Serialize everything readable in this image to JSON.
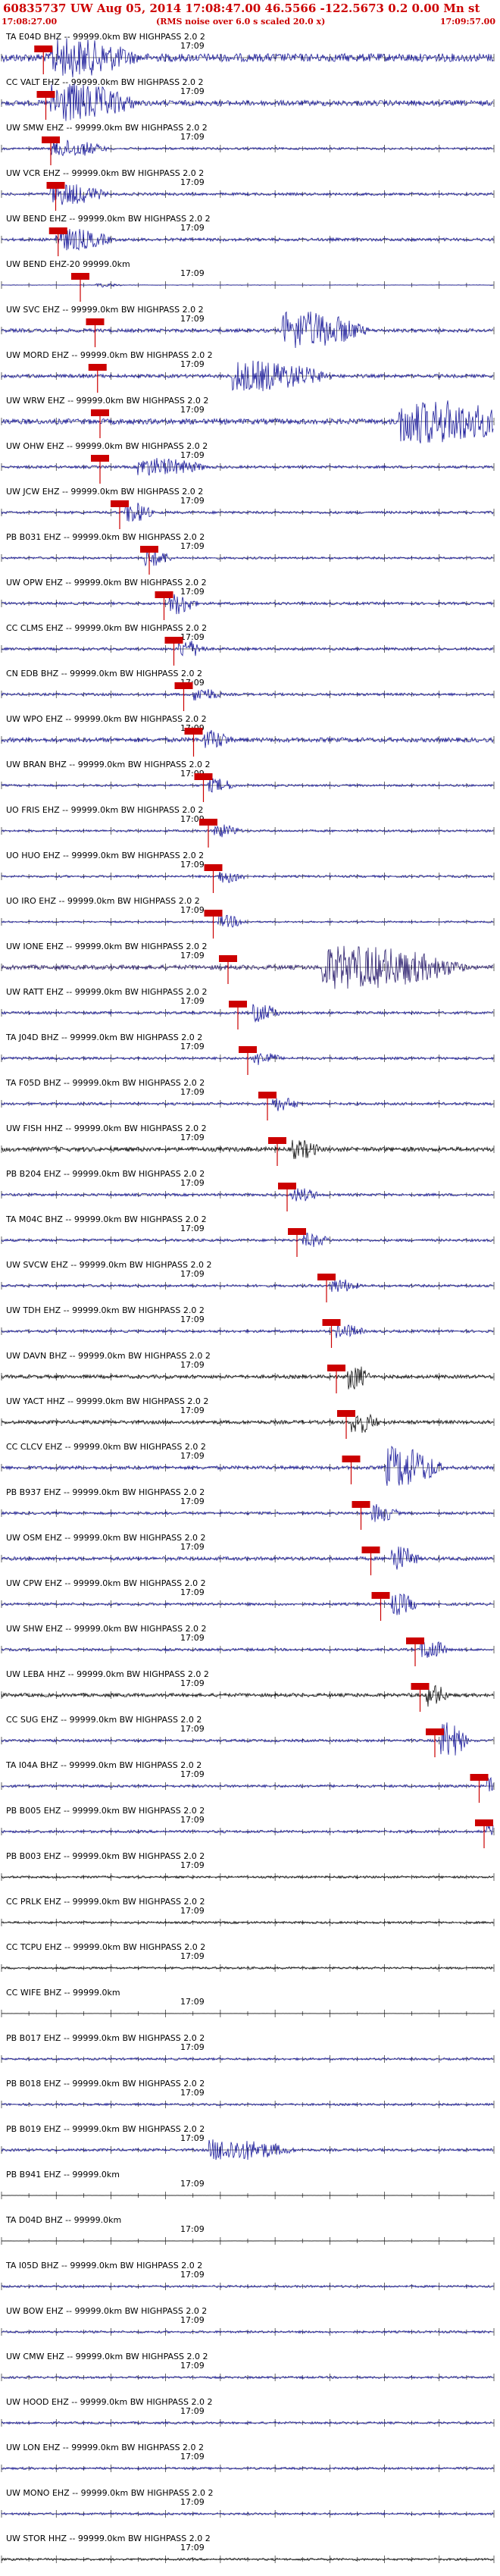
{
  "header": {
    "title": "60835737 UW Aug 05, 2014 17:08:47.00    46.5566 -122.5673   0.2 0.00 Mn st",
    "start_time": "17:08:27.00",
    "end_time": "17:09:57.00",
    "note": "(RMS noise over 6.0 s scaled 20.0 x)"
  },
  "chart_data": {
    "type": "seismogram",
    "center_tick_label": "17:09",
    "x_range": [
      "17:08:27.00",
      "17:09:57.00"
    ],
    "traces": [
      {
        "label": "TA E04D BHZ -- 99999.0km BW  HIGHPASS  2.0  2",
        "color": "#1a1a9a",
        "pick": 0.085,
        "amp": 0.9,
        "burst": [
          0.13,
          0.3,
          0.8
        ]
      },
      {
        "label": "CC VALT EHZ -- 99999.0km BW  HIGHPASS  2.0  2",
        "color": "#1a1a9a",
        "pick": 0.09,
        "amp": 0.6,
        "burst": [
          0.13,
          0.3,
          0.9
        ]
      },
      {
        "label": "UW SMW EHZ -- 99999.0km BW  HIGHPASS  2.0  2",
        "color": "#1a1a9a",
        "pick": 0.1,
        "amp": 0.25,
        "burst": [
          0.12,
          0.2,
          0.4
        ]
      },
      {
        "label": "UW VCR EHZ -- 99999.0km BW  HIGHPASS  2.0  2",
        "color": "#1a1a9a",
        "pick": 0.11,
        "amp": 0.3,
        "burst": [
          0.12,
          0.2,
          0.5
        ]
      },
      {
        "label": "UW BEND EHZ -- 99999.0km BW  HIGHPASS  2.0  2",
        "color": "#1a1a9a",
        "pick": 0.115,
        "amp": 0.35,
        "burst": [
          0.13,
          0.2,
          0.5
        ]
      },
      {
        "label": "UW BEND EHZ-20 99999.0km",
        "color": "#1a1a9a",
        "pick": 0.16,
        "amp": 0.05,
        "burst": [
          0.2,
          0.1,
          0.1
        ]
      },
      {
        "label": "UW SVC EHZ -- 99999.0km BW  HIGHPASS  2.0  2",
        "color": "#1a1a9a",
        "pick": 0.19,
        "amp": 0.4,
        "burst": [
          0.6,
          0.3,
          0.9
        ]
      },
      {
        "label": "UW MORD EHZ -- 99999.0km BW  HIGHPASS  2.0  2",
        "color": "#1a1a9a",
        "pick": 0.195,
        "amp": 0.4,
        "burst": [
          0.5,
          0.35,
          0.7
        ]
      },
      {
        "label": "UW WRW EHZ -- 99999.0km BW  HIGHPASS  2.0  2",
        "color": "#1a1a9a",
        "pick": 0.2,
        "amp": 0.6,
        "burst": [
          0.85,
          0.45,
          1.0
        ]
      },
      {
        "label": "UW OHW EHZ -- 99999.0km BW  HIGHPASS  2.0  2",
        "color": "#1a1a9a",
        "pick": 0.2,
        "amp": 0.3,
        "burst": [
          0.3,
          0.25,
          0.4
        ]
      },
      {
        "label": "UW JCW EHZ -- 99999.0km BW  HIGHPASS  2.0  2",
        "color": "#1a1a9a",
        "pick": 0.24,
        "amp": 0.3,
        "burst": [
          0.26,
          0.1,
          0.5
        ]
      },
      {
        "label": "PB B031 EHZ -- 99999.0km BW  HIGHPASS  2.0  2",
        "color": "#1a1a9a",
        "pick": 0.3,
        "amp": 0.25,
        "burst": [
          0.3,
          0.1,
          0.4
        ]
      },
      {
        "label": "UW OPW EHZ -- 99999.0km BW  HIGHPASS  2.0  2",
        "color": "#1a1a9a",
        "pick": 0.33,
        "amp": 0.3,
        "burst": [
          0.35,
          0.1,
          0.5
        ]
      },
      {
        "label": "CC CLMS EHZ -- 99999.0km BW  HIGHPASS  2.0  2",
        "color": "#1a1a9a",
        "pick": 0.35,
        "amp": 0.3,
        "burst": [
          0.37,
          0.1,
          0.4
        ]
      },
      {
        "label": "CN EDB BHZ -- 99999.0km BW  HIGHPASS  2.0  2",
        "color": "#1a1a9a",
        "pick": 0.37,
        "amp": 0.3,
        "burst": [
          0.4,
          0.1,
          0.3
        ]
      },
      {
        "label": "UW WPO EHZ -- 99999.0km BW  HIGHPASS  2.0  2",
        "color": "#1a1a9a",
        "pick": 0.39,
        "amp": 0.5,
        "burst": [
          0.42,
          0.1,
          0.4
        ]
      },
      {
        "label": "UW BRAN BHZ -- 99999.0km BW  HIGHPASS  2.0  2",
        "color": "#1a1a9a",
        "pick": 0.41,
        "amp": 0.25,
        "burst": [
          0.43,
          0.1,
          0.3
        ]
      },
      {
        "label": "UO FRIS EHZ -- 99999.0km BW  HIGHPASS  2.0  2",
        "color": "#1a1a9a",
        "pick": 0.42,
        "amp": 0.25,
        "burst": [
          0.44,
          0.1,
          0.3
        ]
      },
      {
        "label": "UO HUO EHZ -- 99999.0km BW  HIGHPASS  2.0  2",
        "color": "#1a1a9a",
        "pick": 0.43,
        "amp": 0.25,
        "burst": [
          0.45,
          0.1,
          0.3
        ]
      },
      {
        "label": "UO IRO EHZ -- 99999.0km BW  HIGHPASS  2.0  2",
        "color": "#1a1a9a",
        "pick": 0.43,
        "amp": 0.2,
        "burst": [
          0.45,
          0.1,
          0.3
        ]
      },
      {
        "label": "UW IONE EHZ -- 99999.0km BW  HIGHPASS  2.0  2",
        "color": "#2b1e6e",
        "pick": 0.46,
        "amp": 0.5,
        "burst": [
          0.7,
          0.5,
          1.0
        ]
      },
      {
        "label": "UW RATT EHZ -- 99999.0km BW  HIGHPASS  2.0  2",
        "color": "#1a1a9a",
        "pick": 0.48,
        "amp": 0.3,
        "burst": [
          0.52,
          0.1,
          0.4
        ]
      },
      {
        "label": "TA J04D BHZ -- 99999.0km BW  HIGHPASS  2.0  2",
        "color": "#1a1a9a",
        "pick": 0.5,
        "amp": 0.3,
        "burst": [
          0.52,
          0.1,
          0.3
        ]
      },
      {
        "label": "TA F05D BHZ -- 99999.0km BW  HIGHPASS  2.0  2",
        "color": "#1a1a9a",
        "pick": 0.54,
        "amp": 0.3,
        "burst": [
          0.56,
          0.1,
          0.3
        ]
      },
      {
        "label": "UW FISH HHZ -- 99999.0km BW  HIGHPASS  2.0  2",
        "color": "#111111",
        "pick": 0.56,
        "amp": 0.5,
        "burst": [
          0.6,
          0.1,
          0.4
        ]
      },
      {
        "label": "PB B204 EHZ -- 99999.0km BW  HIGHPASS  2.0  2",
        "color": "#1a1a9a",
        "pick": 0.58,
        "amp": 0.3,
        "burst": [
          0.6,
          0.1,
          0.3
        ]
      },
      {
        "label": "TA M04C BHZ -- 99999.0km BW  HIGHPASS  2.0  2",
        "color": "#1a1a9a",
        "pick": 0.6,
        "amp": 0.3,
        "burst": [
          0.62,
          0.1,
          0.3
        ]
      },
      {
        "label": "UW SVCW EHZ -- 99999.0km BW  HIGHPASS  2.0  2",
        "color": "#1a1a9a",
        "pick": 0.66,
        "amp": 0.3,
        "burst": [
          0.68,
          0.1,
          0.3
        ]
      },
      {
        "label": "UW TDH EHZ -- 99999.0km BW  HIGHPASS  2.0  2",
        "color": "#1a1a9a",
        "pick": 0.67,
        "amp": 0.3,
        "burst": [
          0.69,
          0.1,
          0.3
        ]
      },
      {
        "label": "UW DAVN BHZ -- 99999.0km BW  HIGHPASS  2.0  2",
        "color": "#111111",
        "pick": 0.68,
        "amp": 0.4,
        "burst": [
          0.71,
          0.08,
          0.6
        ]
      },
      {
        "label": "UW YACT HHZ -- 99999.0km BW  HIGHPASS  2.0  2",
        "color": "#111111",
        "pick": 0.7,
        "amp": 0.4,
        "burst": [
          0.72,
          0.1,
          0.5
        ]
      },
      {
        "label": "CC CLCV EHZ -- 99999.0km BW  HIGHPASS  2.0  2",
        "color": "#1a1a9a",
        "pick": 0.71,
        "amp": 0.4,
        "burst": [
          0.8,
          0.2,
          1.0
        ]
      },
      {
        "label": "PB B937 EHZ -- 99999.0km BW  HIGHPASS  2.0  2",
        "color": "#1a1a9a",
        "pick": 0.73,
        "amp": 0.3,
        "burst": [
          0.76,
          0.1,
          0.4
        ]
      },
      {
        "label": "UW OSM EHZ -- 99999.0km BW  HIGHPASS  2.0  2",
        "color": "#1a1a9a",
        "pick": 0.75,
        "amp": 0.4,
        "burst": [
          0.8,
          0.1,
          0.6
        ]
      },
      {
        "label": "UW CPW EHZ -- 99999.0km BW  HIGHPASS  2.0  2",
        "color": "#1a1a9a",
        "pick": 0.77,
        "amp": 0.3,
        "burst": [
          0.8,
          0.1,
          0.5
        ]
      },
      {
        "label": "UW SHW EHZ -- 99999.0km BW  HIGHPASS  2.0  2",
        "color": "#1a1a9a",
        "pick": 0.84,
        "amp": 0.3,
        "burst": [
          0.86,
          0.1,
          0.5
        ]
      },
      {
        "label": "UW LEBA HHZ -- 99999.0km BW  HIGHPASS  2.0  2",
        "color": "#111111",
        "pick": 0.85,
        "amp": 0.4,
        "burst": [
          0.87,
          0.08,
          0.5
        ]
      },
      {
        "label": "CC SUG EHZ -- 99999.0km BW  HIGHPASS  2.0  2",
        "color": "#1a1a9a",
        "pick": 0.88,
        "amp": 0.3,
        "burst": [
          0.9,
          0.1,
          0.9
        ]
      },
      {
        "label": "TA I04A BHZ -- 99999.0km BW  HIGHPASS  2.0  2",
        "color": "#1a1a9a",
        "pick": 0.97,
        "amp": 0.3,
        "burst": [
          0.99,
          0.05,
          0.4
        ]
      },
      {
        "label": "PB B005 EHZ -- 99999.0km BW  HIGHPASS  2.0  2",
        "color": "#1a1a9a",
        "pick": 0.98,
        "amp": 0.3,
        "burst": [
          0.99,
          0.05,
          0.3
        ]
      },
      {
        "label": "PB B003 EHZ -- 99999.0km BW  HIGHPASS  2.0  2",
        "color": "#111111",
        "pick": null,
        "amp": 0.25,
        "burst": null
      },
      {
        "label": "CC PRLK EHZ -- 99999.0km BW  HIGHPASS  2.0  2",
        "color": "#111111",
        "pick": null,
        "amp": 0.25,
        "burst": null
      },
      {
        "label": "CC TCPU EHZ -- 99999.0km BW  HIGHPASS  2.0  2",
        "color": "#111111",
        "pick": null,
        "amp": 0.25,
        "burst": null
      },
      {
        "label": "CC WIFE BHZ -- 99999.0km",
        "color": "#111111",
        "pick": null,
        "amp": 0.02,
        "burst": null
      },
      {
        "label": "PB B017 EHZ -- 99999.0km BW  HIGHPASS  2.0  2",
        "color": "#1a1a9a",
        "pick": null,
        "amp": 0.25,
        "burst": null
      },
      {
        "label": "PB B018 EHZ -- 99999.0km BW  HIGHPASS  2.0  2",
        "color": "#1a1a9a",
        "pick": null,
        "amp": 0.25,
        "burst": null
      },
      {
        "label": "PB B019 EHZ -- 99999.0km BW  HIGHPASS  2.0  2",
        "color": "#1a1a9a",
        "pick": null,
        "amp": 0.3,
        "burst": [
          0.45,
          0.3,
          0.5
        ]
      },
      {
        "label": "PB B941 EHZ -- 99999.0km",
        "color": "#111111",
        "pick": null,
        "amp": 0.02,
        "burst": null
      },
      {
        "label": "TA D04D BHZ -- 99999.0km",
        "color": "#111111",
        "pick": null,
        "amp": 0.02,
        "burst": null
      },
      {
        "label": "TA I05D BHZ -- 99999.0km BW  HIGHPASS  2.0  2",
        "color": "#1a1a9a",
        "pick": null,
        "amp": 0.25,
        "burst": null
      },
      {
        "label": "UW BOW EHZ -- 99999.0km BW  HIGHPASS  2.0  2",
        "color": "#1a1a9a",
        "pick": null,
        "amp": 0.25,
        "burst": null
      },
      {
        "label": "UW CMW EHZ -- 99999.0km BW  HIGHPASS  2.0  2",
        "color": "#1a1a9a",
        "pick": null,
        "amp": 0.25,
        "burst": null
      },
      {
        "label": "UW HOOD EHZ -- 99999.0km BW  HIGHPASS  2.0  2",
        "color": "#1a1a9a",
        "pick": null,
        "amp": 0.25,
        "burst": null
      },
      {
        "label": "UW LON EHZ -- 99999.0km BW  HIGHPASS  2.0  2",
        "color": "#1a1a9a",
        "pick": null,
        "amp": 0.25,
        "burst": null
      },
      {
        "label": "UW MONO EHZ -- 99999.0km BW  HIGHPASS  2.0  2",
        "color": "#1a1a9a",
        "pick": null,
        "amp": 0.25,
        "burst": null
      },
      {
        "label": "UW STOR HHZ -- 99999.0km BW  HIGHPASS  2.0  2",
        "color": "#111111",
        "pick": null,
        "amp": 0.25,
        "burst": null
      }
    ]
  }
}
